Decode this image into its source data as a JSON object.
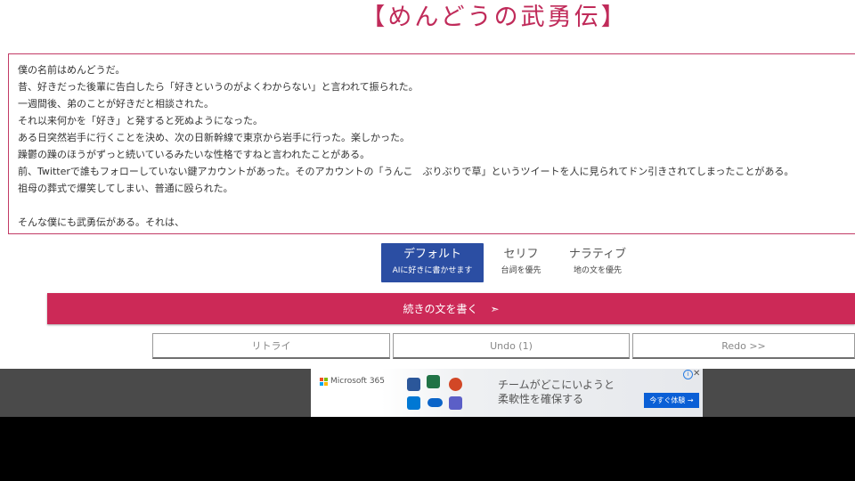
{
  "page": {
    "title": "【めんどうの武勇伝】"
  },
  "story": {
    "text": "僕の名前はめんどうだ。\n昔、好きだった後輩に告白したら「好きというのがよくわからない」と言われて振られた。\n一週間後、弟のことが好きだと相談された。\nそれ以来何かを「好き」と発すると死ぬようになった。\nある日突然岩手に行くことを決め、次の日新幹線で東京から岩手に行った。楽しかった。\n躁鬱の躁のほうがずっと続いているみたいな性格ですねと言われたことがある。\n前、Twitterで誰もフォローしていない鍵アカウントがあった。そのアカウントの「うんこ　ぶりぶりで草」というツイートを人に見られてドン引きされてしまったことがある。\n祖母の葬式で爆笑してしまい、普通に殴られた。\n\nそんな僕にも武勇伝がある。それは、"
  },
  "modes": [
    {
      "title": "デフォルト",
      "subtitle": "AIに好きに書かせます",
      "active": true
    },
    {
      "title": "セリフ",
      "subtitle": "台詞を優先",
      "active": false
    },
    {
      "title": "ナラティブ",
      "subtitle": "地の文を優先",
      "active": false
    }
  ],
  "actions": {
    "continue_label": "続きの文を書く",
    "continue_arrow": "➣",
    "retry_label": "リトライ",
    "undo_label": "Undo (1)",
    "redo_label": "Redo >>"
  },
  "ad": {
    "brand": "Microsoft 365",
    "line1": "チームがどこにいようと",
    "line2": "柔軟性を確保する",
    "cta": "今すぐ体験 →",
    "info_icon": "i",
    "close_icon": "✕"
  },
  "colors": {
    "accent": "#cc2957",
    "title": "#c02b5a",
    "mode_active": "#2b4ea3",
    "ad_cta": "#0a5fd6"
  }
}
